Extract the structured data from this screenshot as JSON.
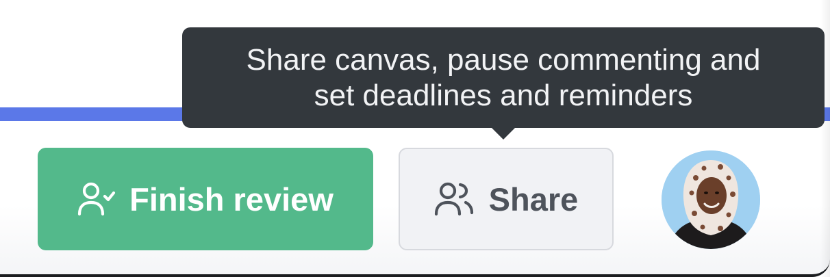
{
  "toolbar": {
    "finish_review": {
      "label": "Finish review",
      "icon": "user-check-icon",
      "color": "#53b98b"
    },
    "share": {
      "label": "Share",
      "icon": "users-icon",
      "background": "#f1f2f5"
    },
    "avatar": {
      "description": "user-avatar"
    }
  },
  "tooltip": {
    "line1": "Share canvas, pause commenting and",
    "line2": "set deadlines and reminders",
    "background": "#33383d"
  },
  "colors": {
    "accent": "#5b78e8"
  }
}
